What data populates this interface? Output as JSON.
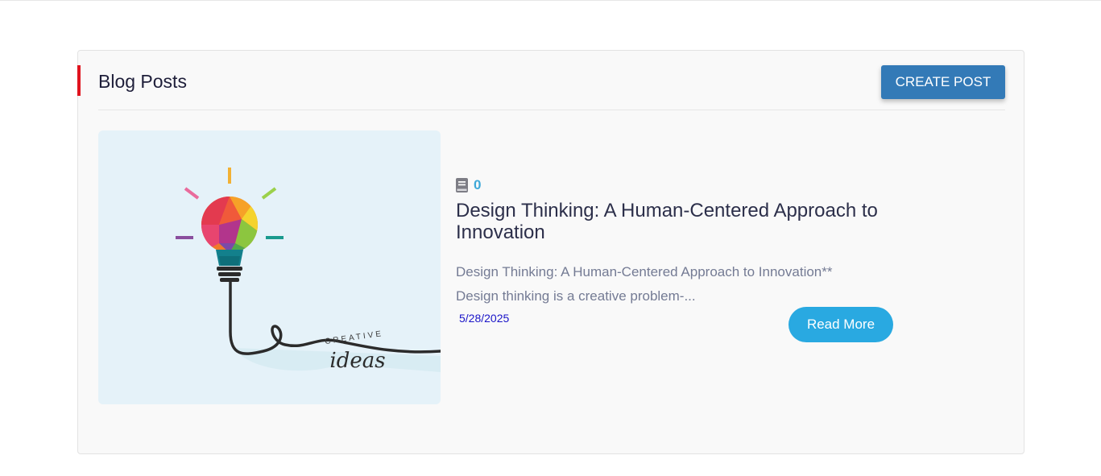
{
  "section": {
    "title": "Blog Posts",
    "create_button_label": "CREATE POST"
  },
  "post": {
    "comment_count": "0",
    "title": "Design Thinking: A Human-Centered Approach to Innovation",
    "excerpt_line1": "Design Thinking: A Human-Centered Approach to Innovation**",
    "excerpt_line2": "Design thinking is a creative problem-...",
    "date": "5/28/2025",
    "read_more_label": "Read More",
    "image": {
      "caption_top": "CREATIVE",
      "caption_bottom": "ideas",
      "icon": "lightbulb-icon"
    }
  },
  "colors": {
    "accent_bar": "#e0141e",
    "create_button": "#337ab7",
    "read_more": "#29a9e1",
    "date": "#1a14c8",
    "comment_count": "#3ea8d8",
    "image_bg": "#e5f2f9"
  }
}
